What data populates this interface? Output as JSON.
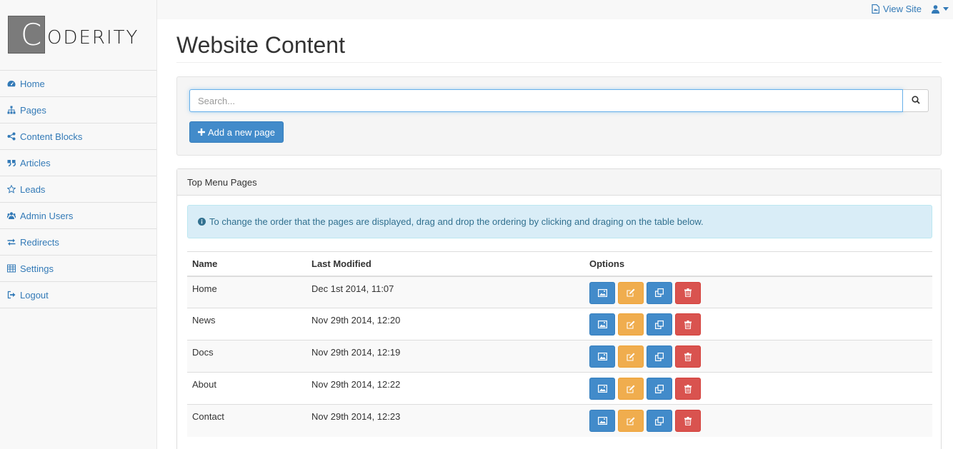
{
  "topbar": {
    "view_site_label": "View Site",
    "icons": [
      "file-icon",
      "user-icon",
      "caret-down-icon"
    ]
  },
  "brand": {
    "initial": "C",
    "rest": "ODERITY"
  },
  "sidebar": {
    "items": [
      {
        "label": "Home",
        "icon": "dashboard-icon"
      },
      {
        "label": "Pages",
        "icon": "sitemap-icon"
      },
      {
        "label": "Content Blocks",
        "icon": "share-icon"
      },
      {
        "label": "Articles",
        "icon": "quote-icon"
      },
      {
        "label": "Leads",
        "icon": "star-icon"
      },
      {
        "label": "Admin Users",
        "icon": "users-icon"
      },
      {
        "label": "Redirects",
        "icon": "exchange-icon"
      },
      {
        "label": "Settings",
        "icon": "table-icon"
      },
      {
        "label": "Logout",
        "icon": "sign-out-icon"
      }
    ]
  },
  "main": {
    "title": "Website Content",
    "search": {
      "placeholder": "Search...",
      "value": ""
    },
    "add_button_label": "Add a new page",
    "panel": {
      "heading": "Top Menu Pages",
      "info": "To change the order that the pages are displayed, drag and drop the ordering by clicking and draging on the table below.",
      "columns": [
        "Name",
        "Last Modified",
        "Options"
      ],
      "rows": [
        {
          "name": "Home",
          "modified": "Dec 1st 2014, 11:07"
        },
        {
          "name": "News",
          "modified": "Nov 29th 2014, 12:20"
        },
        {
          "name": "Docs",
          "modified": "Nov 29th 2014, 12:19"
        },
        {
          "name": "About",
          "modified": "Nov 29th 2014, 12:22"
        },
        {
          "name": "Contact",
          "modified": "Nov 29th 2014, 12:23"
        }
      ],
      "option_icons": [
        "image-icon",
        "edit-icon",
        "copy-icon",
        "trash-icon"
      ]
    }
  },
  "colors": {
    "link": "#337ab7",
    "primary": "#428bca",
    "warning": "#f0ad4e",
    "danger": "#d9534f",
    "info_bg": "#d9edf7",
    "info_text": "#31708f"
  }
}
